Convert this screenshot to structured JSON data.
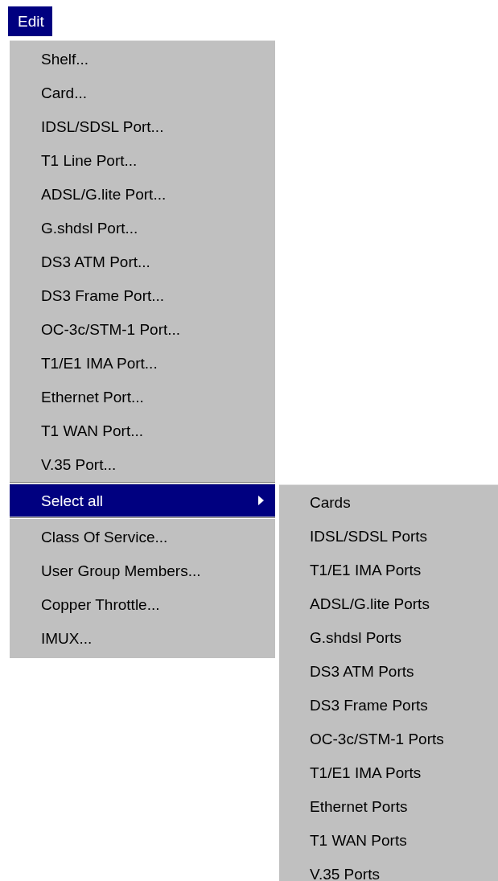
{
  "menubar": [
    {
      "label": "Edit",
      "selected": true
    }
  ],
  "menu": {
    "items": [
      {
        "kind": "item",
        "label": "Shelf...",
        "selected": false
      },
      {
        "kind": "item",
        "label": "Card...",
        "selected": false
      },
      {
        "kind": "item",
        "label": "IDSL/SDSL Port...",
        "selected": false
      },
      {
        "kind": "item",
        "label": "T1 Line Port...",
        "selected": false
      },
      {
        "kind": "item",
        "label": "ADSL/G.lite Port...",
        "selected": false
      },
      {
        "kind": "item",
        "label": "G.shdsl Port...",
        "selected": false
      },
      {
        "kind": "item",
        "label": "DS3 ATM Port...",
        "selected": false
      },
      {
        "kind": "item",
        "label": "DS3 Frame Port...",
        "selected": false
      },
      {
        "kind": "item",
        "label": "OC-3c/STM-1 Port...",
        "selected": false
      },
      {
        "kind": "item",
        "label": "T1/E1 IMA Port...",
        "selected": false
      },
      {
        "kind": "item",
        "label": "Ethernet Port...",
        "selected": false
      },
      {
        "kind": "item",
        "label": "T1 WAN Port...",
        "selected": false
      },
      {
        "kind": "item",
        "label": "V.35 Port...",
        "selected": false
      },
      {
        "kind": "separator"
      },
      {
        "kind": "submenu",
        "label": "Select all",
        "selected": true,
        "expanded": true,
        "children": [
          {
            "label": "Cards",
            "selected": false
          },
          {
            "label": "IDSL/SDSL Ports",
            "selected": false
          },
          {
            "label": "T1/E1 IMA Ports",
            "selected": false
          },
          {
            "label": "ADSL/G.lite Ports",
            "selected": false
          },
          {
            "label": "G.shdsl Ports",
            "selected": false
          },
          {
            "label": "DS3 ATM Ports",
            "selected": false
          },
          {
            "label": "DS3 Frame Ports",
            "selected": false
          },
          {
            "label": "OC-3c/STM-1 Ports",
            "selected": false
          },
          {
            "label": "T1/E1 IMA Ports",
            "selected": false
          },
          {
            "label": "Ethernet Ports",
            "selected": false
          },
          {
            "label": "T1 WAN Ports",
            "selected": false
          },
          {
            "label": "V.35 Ports",
            "selected": false
          }
        ]
      },
      {
        "kind": "separator"
      },
      {
        "kind": "item",
        "label": "Class Of Service...",
        "selected": false
      },
      {
        "kind": "item",
        "label": "User Group Members...",
        "selected": false
      },
      {
        "kind": "item",
        "label": "Copper Throttle...",
        "selected": false
      },
      {
        "kind": "item",
        "label": "IMUX...",
        "selected": false
      }
    ]
  }
}
